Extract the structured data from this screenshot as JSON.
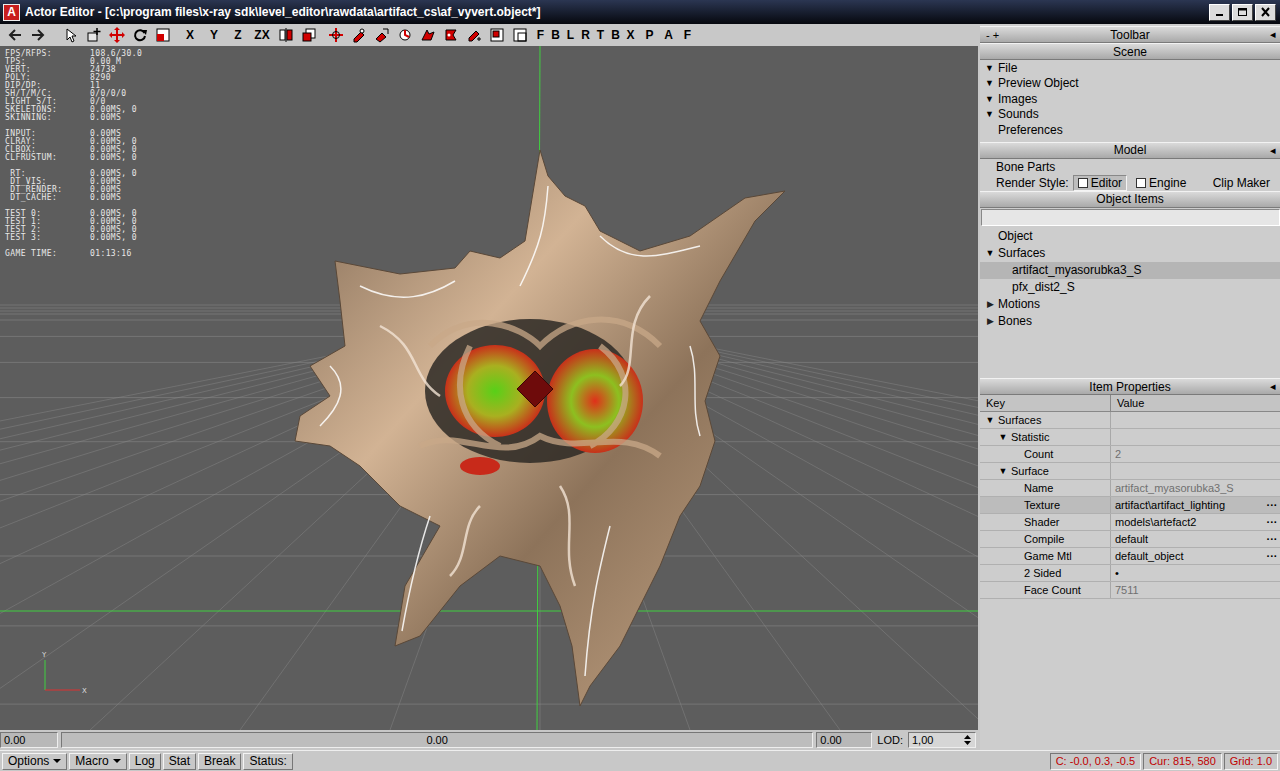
{
  "window": {
    "app_icon": "A",
    "title": "Actor Editor - [c:\\program files\\x-ray sdk\\level_editor\\rawdata\\artifact_cs\\af_vyvert.object*]"
  },
  "toolbar": {
    "axes": [
      "X",
      "Y",
      "Z",
      "ZX"
    ],
    "views": [
      "F",
      "B",
      "L",
      "R",
      "T",
      "B",
      "X"
    ],
    "modes": [
      "P",
      "A",
      "F"
    ]
  },
  "viewport": {
    "stats": [
      [
        {
          "label": "FPS/RFPS:",
          "value": "108.6/30.0"
        },
        {
          "label": "TPS:",
          "value": "0.00 M"
        },
        {
          "label": "VERT:",
          "value": "24738"
        },
        {
          "label": "POLY:",
          "value": "8290"
        },
        {
          "label": "DIP/DP:",
          "value": "11"
        },
        {
          "label": "SH/T/M/C:",
          "value": "0/0/0/0"
        },
        {
          "label": "LIGHT S/T:",
          "value": "0/0"
        },
        {
          "label": "SKELETONS:",
          "value": "0.00MS, 0"
        },
        {
          "label": "SKINNING:",
          "value": "0.00MS"
        }
      ],
      [
        {
          "label": "INPUT:",
          "value": "0.00MS"
        },
        {
          "label": "CLRAY:",
          "value": "0.00MS, 0"
        },
        {
          "label": "CLBOX:",
          "value": "0.00MS, 0"
        },
        {
          "label": "CLFRUSTUM:",
          "value": "0.00MS, 0"
        }
      ],
      [
        {
          "label": " RT:",
          "value": "0.00MS, 0"
        },
        {
          "label": " DT_VIS:",
          "value": "0.00MS"
        },
        {
          "label": " DT_RENDER:",
          "value": "0.00MS"
        },
        {
          "label": " DT_CACHE:",
          "value": "0.00MS"
        }
      ],
      [
        {
          "label": "TEST 0:",
          "value": "0.00MS, 0"
        },
        {
          "label": "TEST 1:",
          "value": "0.00MS, 0"
        },
        {
          "label": "TEST 2:",
          "value": "0.00MS, 0"
        },
        {
          "label": "TEST 3:",
          "value": "0.00MS, 0"
        }
      ],
      [
        {
          "label": "GAME TIME:",
          "value": "01:13:16"
        }
      ]
    ],
    "gizmo": {
      "y": "Y",
      "x": "X"
    }
  },
  "timeline": {
    "start": "0.00",
    "current": "0.00",
    "end": "0.00",
    "lod_label": "LOD:",
    "lod": "1,00"
  },
  "panel": {
    "toolbar": {
      "controls": "- +",
      "title": "Toolbar",
      "collapse": "◂"
    },
    "scene": {
      "title": "Scene",
      "items": [
        {
          "arrow": "▼",
          "label": "File"
        },
        {
          "arrow": "▼",
          "label": "Preview Object"
        },
        {
          "arrow": "▼",
          "label": "Images"
        },
        {
          "arrow": "▼",
          "label": "Sounds"
        },
        {
          "label": "Preferences"
        }
      ]
    },
    "model": {
      "title": "Model",
      "collapse": "◂",
      "bone_parts": "Bone Parts",
      "render_style": {
        "label": "Render Style:",
        "options": [
          {
            "label": "Editor",
            "checked": false,
            "selected": true
          },
          {
            "label": "Engine",
            "checked": false,
            "selected": false
          }
        ]
      },
      "clip_maker": "Clip Maker"
    },
    "object_items": {
      "title": "Object Items",
      "tree": [
        {
          "depth": 0,
          "label": "Object",
          "selected": false
        },
        {
          "depth": 0,
          "toggle": "▼",
          "expanded": true,
          "label": "Surfaces",
          "selected": false
        },
        {
          "depth": 1,
          "label": "artifact_myasorubka3_S",
          "selected": true
        },
        {
          "depth": 1,
          "label": "pfx_dist2_S",
          "selected": false
        },
        {
          "depth": 0,
          "toggle": "▶",
          "expanded": false,
          "label": "Motions",
          "selected": false
        },
        {
          "depth": 0,
          "toggle": "▶",
          "expanded": false,
          "label": "Bones",
          "selected": false
        }
      ]
    },
    "properties": {
      "title": "Item Properties",
      "collapse": "◂",
      "columns": [
        "Key",
        "Value"
      ],
      "rows": [
        {
          "depth": 0,
          "toggle": "▼",
          "expanded": true,
          "key": "Surfaces",
          "selected": false
        },
        {
          "depth": 1,
          "toggle": "▼",
          "expanded": true,
          "key": "Statistic",
          "selected": false
        },
        {
          "depth": 2,
          "key": "Count",
          "value": "2",
          "readonly": true,
          "selected": false
        },
        {
          "depth": 1,
          "toggle": "▼",
          "expanded": true,
          "key": "Surface",
          "selected": false
        },
        {
          "depth": 2,
          "key": "Name",
          "value": "artifact_myasorubka3_S",
          "readonly": true,
          "selected": false
        },
        {
          "depth": 2,
          "key": "Texture",
          "value": "artifact\\artifact_lighting",
          "readonly": false,
          "button": "···",
          "selected": true
        },
        {
          "depth": 2,
          "key": "Shader",
          "value": "models\\artefact2",
          "readonly": false,
          "button": "···",
          "selected": false
        },
        {
          "depth": 2,
          "key": "Compile",
          "value": "default",
          "readonly": false,
          "button": "···",
          "selected": false
        },
        {
          "depth": 2,
          "key": "Game Mtl",
          "value": "default_object",
          "readonly": false,
          "button": "···",
          "selected": false
        },
        {
          "depth": 2,
          "key": "2 Sided",
          "value": "•",
          "readonly": false,
          "selected": false
        },
        {
          "depth": 2,
          "key": "Face Count",
          "value": "7511",
          "readonly": true,
          "selected": false
        }
      ]
    }
  },
  "status_bar": {
    "buttons": [
      {
        "label": "Options",
        "dropdown": true
      },
      {
        "label": "Macro",
        "dropdown": true
      },
      {
        "label": "Log",
        "dropdown": false
      },
      {
        "label": "Stat",
        "dropdown": false
      },
      {
        "label": "Break",
        "dropdown": false
      },
      {
        "label": "Status:",
        "dropdown": false
      }
    ],
    "readouts": [
      "C: -0.0, 0.3, -0.5",
      "Cur: 815, 580",
      "Grid: 1.0"
    ]
  }
}
